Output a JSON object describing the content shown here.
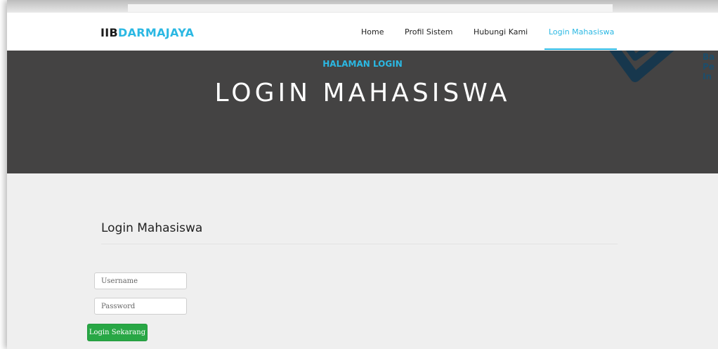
{
  "navbar": {
    "brand_prefix": "IIB",
    "brand_suffix": "DARMAJAYA",
    "items": [
      {
        "label": "Home"
      },
      {
        "label": "Profil Sistem"
      },
      {
        "label": "Hubungi Kami"
      },
      {
        "label": "Login Mahasiswa",
        "active": true
      }
    ]
  },
  "hero": {
    "subtitle": "HALAMAN LOGIN",
    "title": "LOGIN MAHASISWA",
    "logo_text": [
      "Ba",
      "Pe",
      "In"
    ]
  },
  "form": {
    "title": "Login Mahasiswa",
    "username_placeholder": "Username",
    "password_placeholder": "Password",
    "submit_label": "Login Sekarang"
  },
  "colors": {
    "accent": "#2bb8e3",
    "hero_bg": "#444343",
    "button": "#28a745",
    "content_bg": "#efefef"
  },
  "icons": {
    "logo": "chevron-logo-icon"
  }
}
